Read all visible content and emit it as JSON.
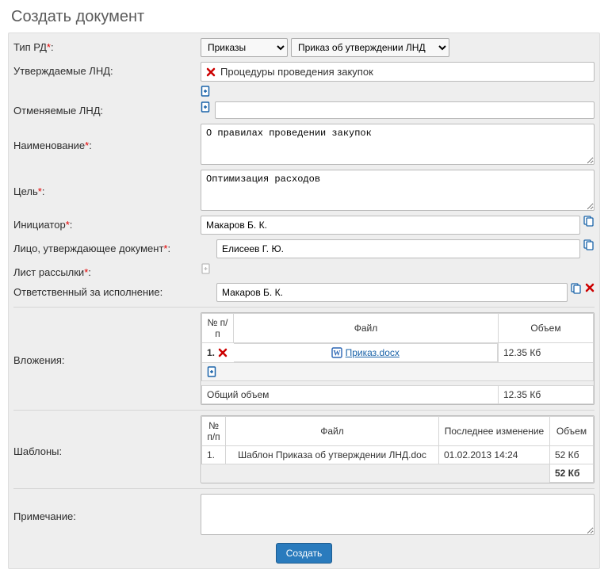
{
  "title": "Создать документ",
  "labels": {
    "type_rd": "Тип РД",
    "approved_lnd": "Утверждаемые ЛНД:",
    "cancelled_lnd": "Отменяемые ЛНД:",
    "name": "Наименование",
    "goal": "Цель",
    "initiator": "Инициатор",
    "approver": "Лицо, утверждающее документ",
    "mailing_list": "Лист рассылки",
    "responsible": "Ответственный за исполнение:",
    "attachments": "Вложения:",
    "templates": "Шаблоны:",
    "note": "Примечание:"
  },
  "type_rd": {
    "select1": "Приказы",
    "select2": "Приказ об утверждении ЛНД"
  },
  "approved_lnd_value": "Процедуры проведения закупок",
  "name_value": "О правилах проведении закупок",
  "goal_value": "Оптимизация расходов",
  "initiator_value": "Макаров Б. К.",
  "approver_value": "Елисеев Г. Ю.",
  "responsible_value": "Макаров Б. К.",
  "attachments_table": {
    "headers": {
      "idx": "№ п/п",
      "file": "Файл",
      "size": "Объем"
    },
    "rows": [
      {
        "idx": "1.",
        "file": "Приказ.docx",
        "size": "12.35 Кб"
      }
    ],
    "total_label": "Общий объем",
    "total_size": "12.35 Кб"
  },
  "templates_table": {
    "headers": {
      "idx": "№ п/п",
      "file": "Файл",
      "date": "Последнее изменение",
      "size": "Объем"
    },
    "rows": [
      {
        "idx": "1.",
        "file": "Шаблон Приказа об утверждении ЛНД.doc",
        "date": "01.02.2013 14:24",
        "size": "52 Кб"
      }
    ],
    "total_size": "52 Кб"
  },
  "submit_label": "Создать"
}
